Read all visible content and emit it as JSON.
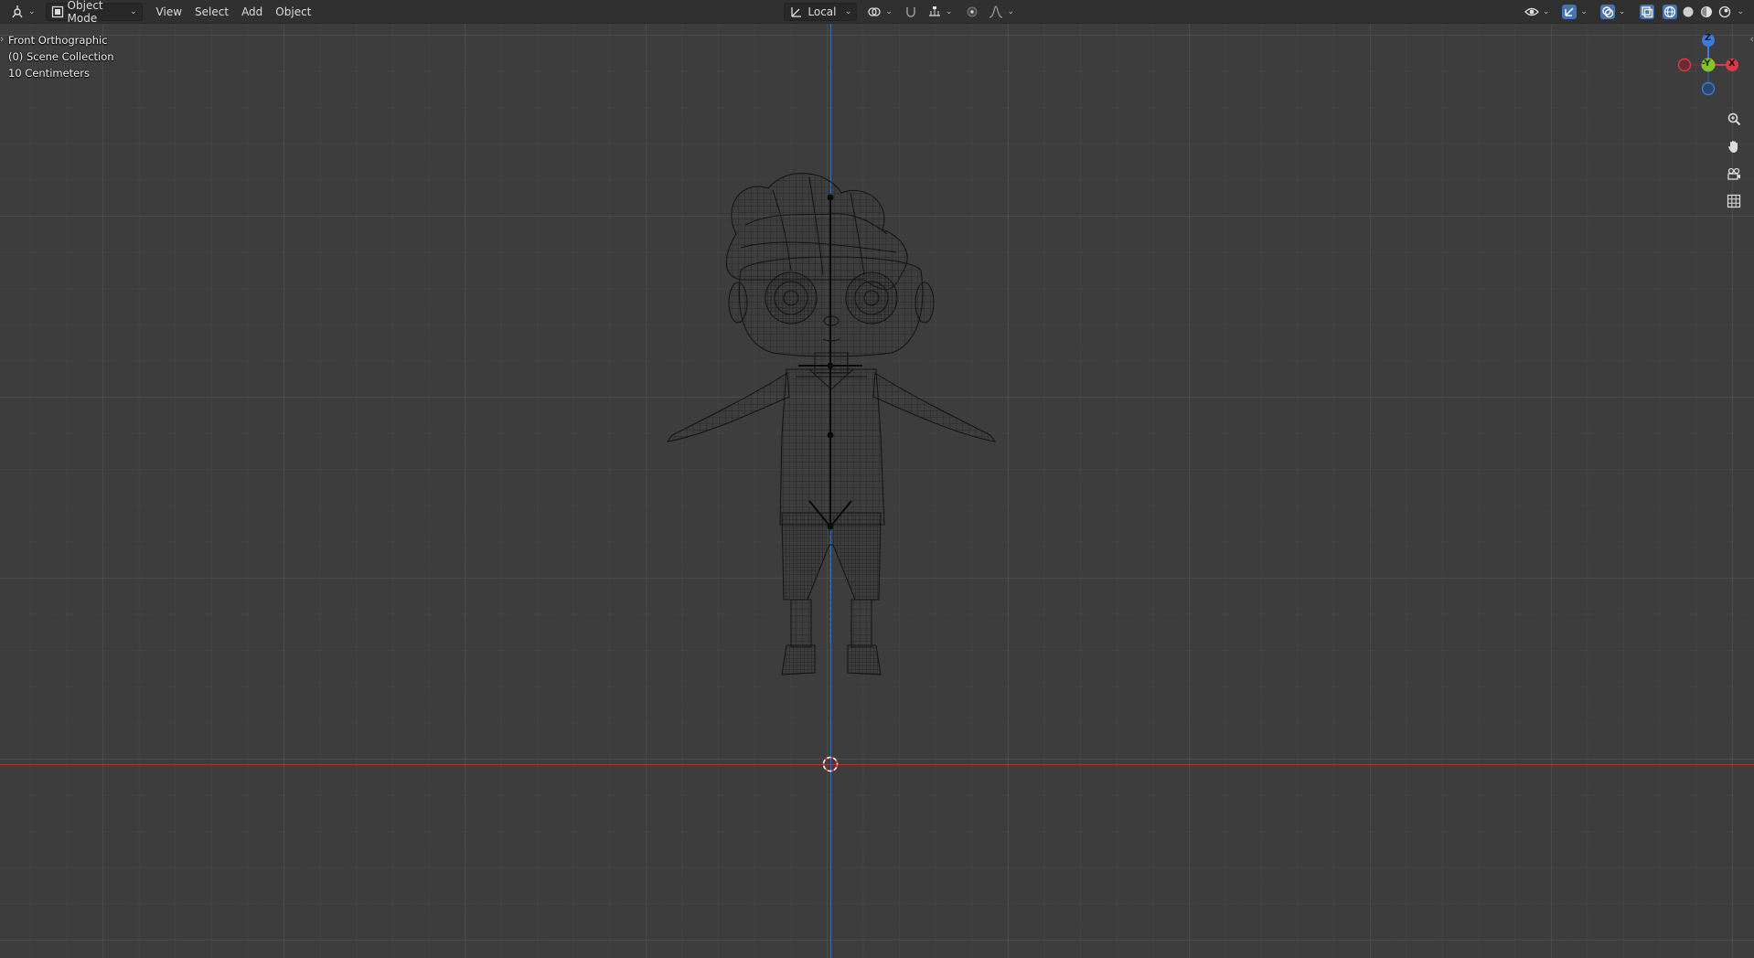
{
  "header": {
    "editor_type_icon": "editor-3d-viewport-icon",
    "mode": {
      "label": "Object Mode",
      "icon": "object-mode-icon"
    },
    "menus": [
      "View",
      "Select",
      "Add",
      "Object"
    ],
    "transform_orientation": {
      "label": "Local",
      "icon": "transform-orientation-icon"
    },
    "pivot_icon": "pivot-point-icon",
    "snap_icon": "snap-icon",
    "proportional_icon": "proportional-editing-icon",
    "right_icons": [
      "visibility-icon",
      "gizmo-icon",
      "overlay-icon",
      "xray-icon",
      "wireframe-shading-icon",
      "solid-shading-icon",
      "material-shading-icon",
      "rendered-shading-icon"
    ]
  },
  "viewport": {
    "view_name": "Front Orthographic",
    "collection": "(0) Scene Collection",
    "grid_scale": "10 Centimeters",
    "shading": "wireframe",
    "colors": {
      "background": "#3d3d3d",
      "x_axis": "#a8383e",
      "z_axis": "#3a6fb5",
      "wire": "#111111"
    }
  },
  "gizmo": {
    "z_label": "Z",
    "y_label": "-Y",
    "x_label": "X",
    "colors": {
      "x": "#d63b48",
      "y": "#84c427",
      "z": "#3d7bd6"
    }
  },
  "nav_tools": [
    "zoom-icon",
    "pan-hand-icon",
    "camera-view-icon",
    "ortho-grid-icon"
  ]
}
